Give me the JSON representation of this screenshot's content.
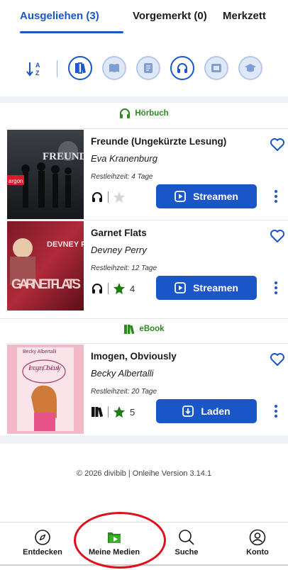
{
  "tabs": [
    {
      "label": "Ausgeliehen (3)"
    },
    {
      "label": "Vorgemerkt (0)"
    },
    {
      "label": "Merkzett"
    }
  ],
  "filters": {
    "sort_icon": "sort-alpha-icon",
    "types": [
      {
        "icon": "all-media-icon",
        "active": true
      },
      {
        "icon": "ebook-icon",
        "active": false
      },
      {
        "icon": "epaper-icon",
        "active": false
      },
      {
        "icon": "audiobook-icon",
        "active": true
      },
      {
        "icon": "video-icon",
        "active": false
      },
      {
        "icon": "elearning-icon",
        "active": false
      }
    ]
  },
  "sections": [
    {
      "label": "Hörbuch",
      "icon": "headphones-icon",
      "items": [
        {
          "title": "Freunde (Ungekürzte Lesung)",
          "author": "Eva Kranenburg",
          "loan_time": "Restleihzeit: 4 Tage",
          "rating_count": "",
          "rated": false,
          "action_label": "Streamen",
          "action_icon": "play-icon",
          "cover_text": "FREUNDE",
          "cover_publisher": "argon"
        },
        {
          "title": "Garnet Flats",
          "author": "Devney Perry",
          "loan_time": "Restleihzeit: 12 Tage",
          "rating_count": "4",
          "rated": true,
          "action_label": "Streamen",
          "action_icon": "play-icon",
          "cover_text_top": "DEVNEY PERRY",
          "cover_text_main": "GARNET FLATS"
        }
      ]
    },
    {
      "label": "eBook",
      "icon": "ebook-icon",
      "items": [
        {
          "title": "Imogen, Obviously",
          "author": "Becky Albertalli",
          "loan_time": "Restleihzeit: 20 Tage",
          "rating_count": "5",
          "rated": true,
          "action_label": "Laden",
          "action_icon": "download-icon",
          "cover_author": "Becky Albertalli",
          "cover_title": "Imogen, Obviously"
        }
      ]
    }
  ],
  "footer": "© 2026 divibib | Onleihe Version 3.14.1",
  "bottom_nav": [
    {
      "label": "Entdecken",
      "icon": "compass-icon"
    },
    {
      "label": "Meine Medien",
      "icon": "my-media-icon",
      "active": true
    },
    {
      "label": "Suche",
      "icon": "search-icon"
    },
    {
      "label": "Konto",
      "icon": "account-icon"
    }
  ],
  "colors": {
    "accent": "#1a56c8",
    "green": "#2a8a1c",
    "highlight": "#e0101a"
  }
}
